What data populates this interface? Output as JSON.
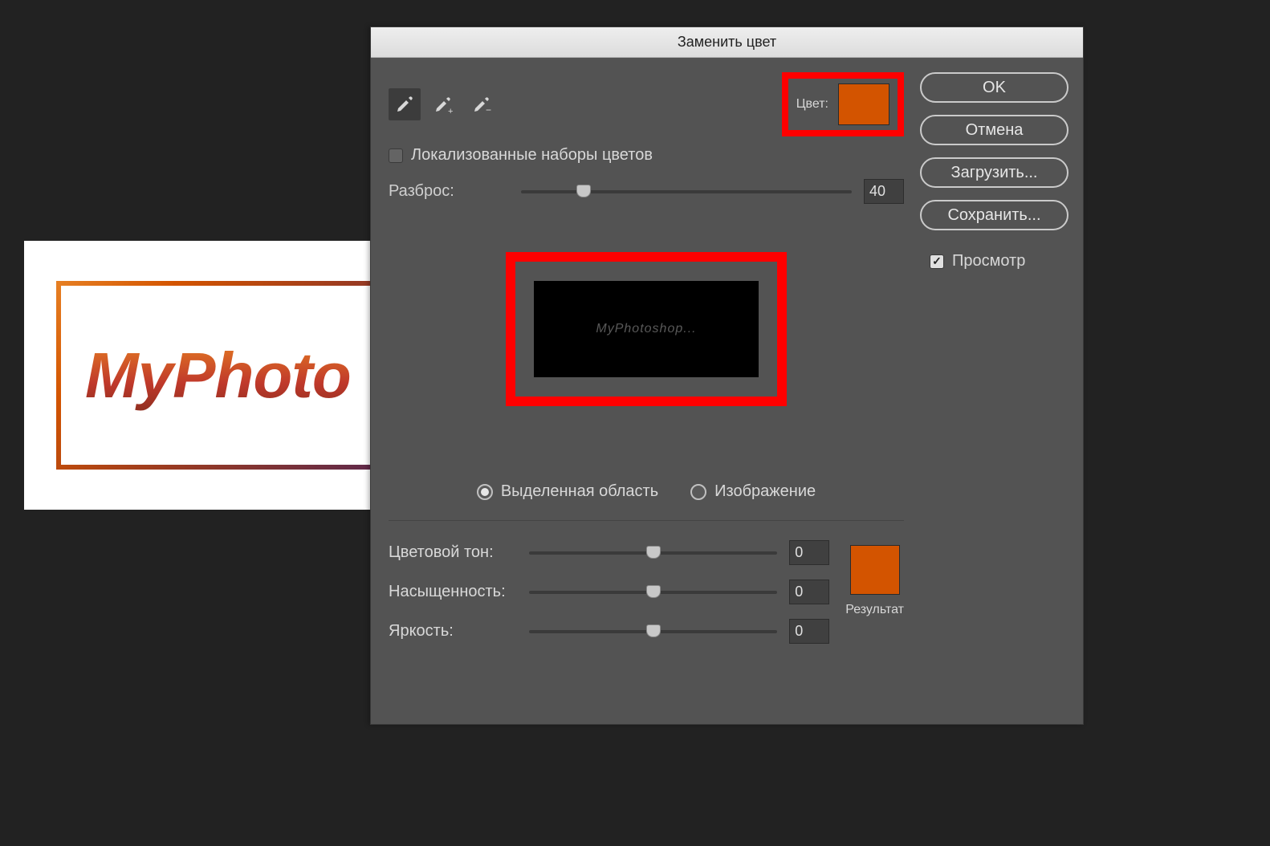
{
  "canvas": {
    "logo_text": "MyPhoto"
  },
  "dialog": {
    "title": "Заменить цвет",
    "color_label": "Цвет:",
    "color_swatch": "#d35400",
    "localized_clusters": {
      "label": "Локализованные наборы цветов",
      "checked": false
    },
    "fuzziness": {
      "label": "Разброс:",
      "value": "40",
      "thumb_pct": 19
    },
    "preview_text": "MyPhotoshop...",
    "view_mode": {
      "selection": "Выделенная область",
      "image": "Изображение",
      "selected": "selection"
    },
    "hue": {
      "label": "Цветовой тон:",
      "value": "0"
    },
    "saturation": {
      "label": "Насыщенность:",
      "value": "0"
    },
    "lightness": {
      "label": "Яркость:",
      "value": "0"
    },
    "result_label": "Результат",
    "result_swatch": "#d35400"
  },
  "buttons": {
    "ok": "OK",
    "cancel": "Отмена",
    "load": "Загрузить...",
    "save": "Сохранить..."
  },
  "preview_checkbox": {
    "label": "Просмотр",
    "checked": true
  }
}
